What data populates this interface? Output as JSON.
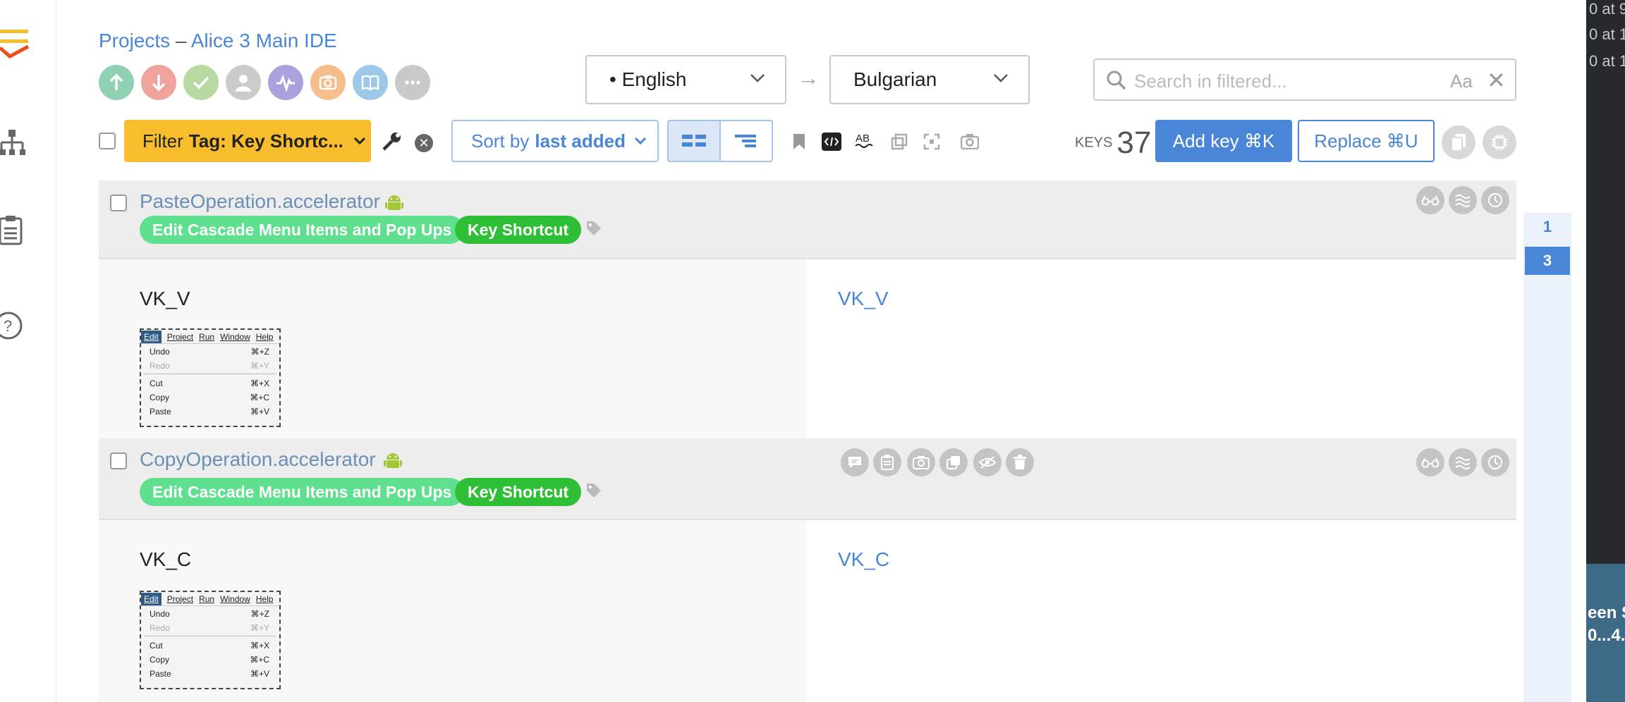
{
  "breadcrumb": {
    "projects": "Projects",
    "separator": "–",
    "project": "Alice 3 Main IDE"
  },
  "languages": {
    "source": "• English",
    "arrow": "→",
    "target": "Bulgarian"
  },
  "search": {
    "placeholder": "Search in filtered...",
    "case_toggle": "Aa",
    "clear": "✕"
  },
  "toolbar": {
    "filter_prefix": "Filter",
    "filter_value": "Tag: Key Shortc...",
    "sort_prefix": "Sort by",
    "sort_value": "last added",
    "keys_label": "KEYS",
    "keys_count": "37",
    "add_key": "Add key ⌘K",
    "replace": "Replace ⌘U"
  },
  "keys": [
    {
      "name": "PasteOperation.accelerator",
      "tags": [
        "Edit Cascade Menu Items and Pop Ups",
        "Key Shortcut"
      ],
      "source": "VK_V",
      "translation": "VK_V"
    },
    {
      "name": "CopyOperation.accelerator",
      "tags": [
        "Edit Cascade Menu Items and Pop Ups",
        "Key Shortcut"
      ],
      "source": "VK_C",
      "translation": "VK_C"
    }
  ],
  "screenshot_menu": {
    "menubar": [
      "Edit",
      "Project",
      "Run",
      "Window",
      "Help"
    ],
    "items": [
      {
        "label": "Undo",
        "shortcut": "⌘+Z",
        "dim": false
      },
      {
        "label": "Redo",
        "shortcut": "⌘+Y",
        "dim": true
      },
      {
        "label": "Cut",
        "shortcut": "⌘+X",
        "dim": false
      },
      {
        "label": "Copy",
        "shortcut": "⌘+C",
        "dim": false
      },
      {
        "label": "Paste",
        "shortcut": "⌘+V",
        "dim": false
      }
    ]
  },
  "pagination": {
    "pages": [
      "1",
      "3"
    ],
    "active": "3"
  },
  "desktop": {
    "lines": [
      "0 at 9",
      "0 at 1",
      "0 at 1"
    ],
    "thumb": [
      "een S",
      "0...4."
    ]
  },
  "colors": {
    "accent": "#4a86d8",
    "filter": "#f8bd2c",
    "tag_light": "#5fe08e",
    "tag_dark": "#2fbf36"
  }
}
